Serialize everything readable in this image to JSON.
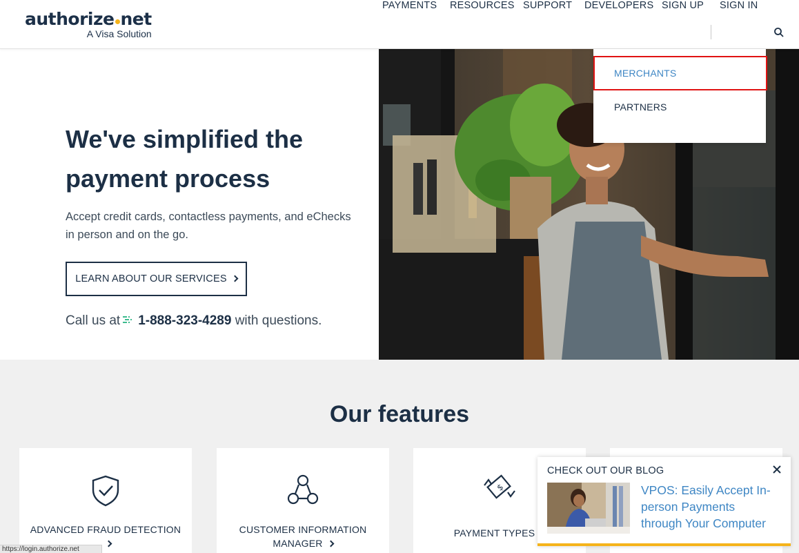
{
  "header": {
    "logo_main_a": "authorize",
    "logo_main_b": "net",
    "logo_sub": "A Visa Solution",
    "nav": [
      "PAYMENTS",
      "RESOURCES",
      "SUPPORT",
      "DEVELOPERS",
      "SIGN UP",
      "SIGN IN"
    ]
  },
  "dropdown": {
    "items": [
      "MERCHANTS",
      "PARTNERS"
    ]
  },
  "hero": {
    "title": "We've simplified the payment process",
    "subtitle": "Accept credit cards, contactless payments, and eChecks in person and on the go.",
    "button": "LEARN ABOUT OUR SERVICES",
    "call_prefix": "Call us at",
    "phone": "1-888-323-4289",
    "call_suffix": "with questions."
  },
  "features": {
    "title": "Our features",
    "cards": [
      "ADVANCED FRAUD DETECTION",
      "CUSTOMER INFORMATION MANAGER",
      "PAYMENT TYPES"
    ]
  },
  "blog": {
    "heading": "CHECK OUT OUR BLOG",
    "link": "VPOS: Easily Accept In-person Payments through Your Computer"
  },
  "status_bar": "https://login.authorize.net",
  "colors": {
    "navy": "#1c2f45",
    "link_blue": "#3e86c4",
    "accent_yellow": "#f5b31a",
    "highlight_red": "#e01212",
    "phone_green": "#3dbb8e"
  }
}
